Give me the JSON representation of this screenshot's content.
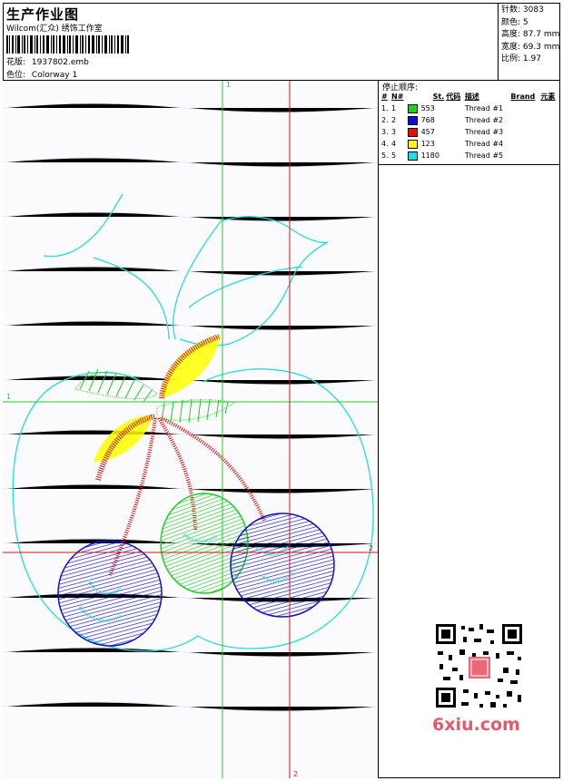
{
  "header": {
    "title": "生产作业图",
    "company": "Wilcom(汇众) 绣饰工作室",
    "design_label": "花版:",
    "design_value": "1937802.emb",
    "colorway_label": "色位:",
    "colorway_value": "Colorway 1"
  },
  "specs": [
    {
      "label": "针数:",
      "value": "3083"
    },
    {
      "label": "颜色:",
      "value": "5"
    },
    {
      "label": "高度:",
      "value": "87.7 mm"
    },
    {
      "label": "宽度:",
      "value": "69.3 mm"
    },
    {
      "label": "比例:",
      "value": "1.97"
    }
  ],
  "canvas": {
    "axis_v1": "1",
    "axis_h1": "1",
    "axis_h2": "2",
    "axis_v2": "2"
  },
  "stop_sequence": {
    "title": "停止顺序:",
    "columns": [
      "#",
      "N#",
      "St.",
      "代码",
      "描述",
      "Brand",
      "元素"
    ],
    "rows": [
      {
        "num": "1.",
        "n": "1",
        "color": "#22cc22",
        "st": "553",
        "desc": "Thread #1"
      },
      {
        "num": "2.",
        "n": "2",
        "color": "#1111cc",
        "st": "768",
        "desc": "Thread #2"
      },
      {
        "num": "3.",
        "n": "3",
        "color": "#dd1111",
        "st": "457",
        "desc": "Thread #3"
      },
      {
        "num": "4.",
        "n": "4",
        "color": "#ffff00",
        "st": "123",
        "desc": "Thread #4"
      },
      {
        "num": "5.",
        "n": "5",
        "color": "#22dddd",
        "st": "1180",
        "desc": "Thread #5"
      }
    ]
  },
  "watermark": "6xiu.com",
  "colors": {
    "green": "#22cc22",
    "blue": "#1111cc",
    "red": "#dd1111",
    "yellow": "#ffff00",
    "cyan": "#22dddd"
  }
}
